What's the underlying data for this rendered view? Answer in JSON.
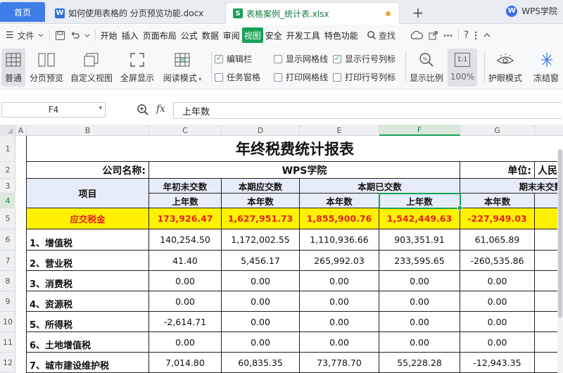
{
  "tabs": {
    "home": "首页",
    "doc": "如何使用表格的 分页预览功能.docx",
    "xls": "表格案例_统计表.xlsx",
    "add": "+",
    "brand": "WPS学院",
    "doc_icon": "W",
    "xls_icon": "S",
    "brand_icon": "W"
  },
  "menu": {
    "hamburger_icon": "☰",
    "file": "文件",
    "items": [
      "开始",
      "插入",
      "页面布局",
      "公式",
      "数据",
      "审阅",
      "视图",
      "安全",
      "开发工具",
      "特色功能"
    ],
    "active": "视图",
    "search": "查找"
  },
  "ribbon": {
    "buttons": [
      "普通",
      "分页预览",
      "自定义视图",
      "全屏显示",
      "阅读模式"
    ],
    "checks": [
      {
        "label": "编辑栏",
        "checked": true
      },
      {
        "label": "显示网格线",
        "checked": false
      },
      {
        "label": "显示行号列标",
        "checked": true
      },
      {
        "label": "任务窗格",
        "checked": false
      },
      {
        "label": "打印网格线",
        "checked": false
      },
      {
        "label": "打印行号列标",
        "checked": false
      }
    ],
    "ratio_label": "显示比例",
    "zoom_label": "100%",
    "zoom_box": "1:1",
    "eye_label": "护眼模式",
    "freeze_label": "冻结窗"
  },
  "formula_bar": {
    "cell_ref": "F4",
    "fx": "fx",
    "value": "上年数"
  },
  "columns": [
    "A",
    "B",
    "C",
    "D",
    "E",
    "F",
    "G",
    ""
  ],
  "selected_column": "F",
  "rows": [
    "1",
    "2",
    "3",
    "4",
    "5",
    "6",
    "7",
    "8",
    "9",
    "10",
    "11",
    "12"
  ],
  "selected_row": "4",
  "sheet": {
    "title": "年终税费统计报表",
    "company_label": "公司名称:",
    "company_value": "WPS学院",
    "unit_label": "单位:",
    "unit_value": "人民",
    "item_header": "项目",
    "group_headers": [
      "年初未交数",
      "本期应交数",
      "本期已交数",
      "期末未交数"
    ],
    "sub_headers": [
      "上年数",
      "本年数",
      "本年数",
      "上年数",
      "本年数",
      ""
    ],
    "total_row": {
      "label": "应交税金",
      "values": [
        "173,926.47",
        "1,627,951.73",
        "1,855,900.76",
        "1,542,449.63",
        "-227,949.03",
        "-"
      ]
    },
    "data_rows": [
      {
        "label": "1、增值税",
        "values": [
          "140,254.50",
          "1,172,002.55",
          "1,110,936.66",
          "903,351.91",
          "61,065.89",
          ""
        ]
      },
      {
        "label": "2、营业税",
        "values": [
          "41.40",
          "5,456.17",
          "265,992.03",
          "233,595.65",
          "-260,535.86",
          ""
        ]
      },
      {
        "label": "3、消费税",
        "values": [
          "0.00",
          "0.00",
          "0.00",
          "0.00",
          "0.00",
          ""
        ]
      },
      {
        "label": "4、资源税",
        "values": [
          "0.00",
          "0.00",
          "0.00",
          "0.00",
          "0.00",
          ""
        ]
      },
      {
        "label": "5、所得税",
        "values": [
          "-2,614.71",
          "0.00",
          "0.00",
          "0.00",
          "0.00",
          ""
        ]
      },
      {
        "label": "6、土地增值税",
        "values": [
          "0.00",
          "0.00",
          "0.00",
          "0.00",
          "0.00",
          ""
        ]
      },
      {
        "label": "7、城市建设维护税",
        "values": [
          "7,014.80",
          "60,835.35",
          "73,778.70",
          "55,228.28",
          "-12,943.35",
          ""
        ]
      }
    ]
  },
  "colors": {
    "accent": "#1aa057",
    "home_tab": "#3f7ee8",
    "highlight_row": "#fff100",
    "highlight_text": "#e2231a",
    "header_fill": "#e6edf8"
  }
}
